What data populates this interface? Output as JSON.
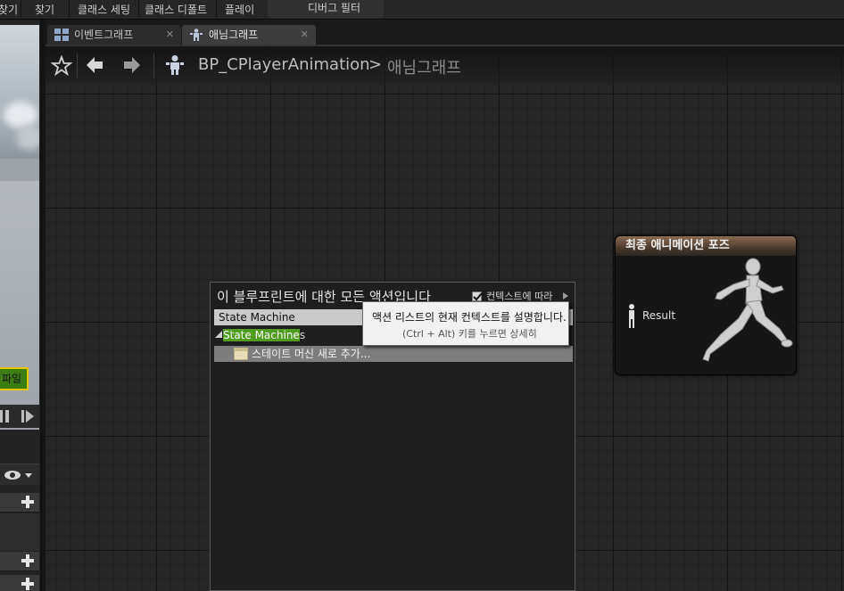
{
  "toolbar": {
    "items": [
      "찾기",
      "찾기",
      "클래스 세팅",
      "클래스 디폴트",
      "플레이"
    ],
    "debug_filter": "디버그 필터"
  },
  "left_panel": {
    "compile_label": "파일"
  },
  "tabs": [
    {
      "label": "이벤트그래프",
      "active": false
    },
    {
      "label": "애님그래프",
      "active": true
    }
  ],
  "breadcrumb": {
    "blueprint": "BP_CPlayerAnimation",
    "separator": ">",
    "graph": "애님그래프"
  },
  "result_node": {
    "title": "최종 애니메이션 포즈",
    "pin_label": "Result"
  },
  "action_menu": {
    "title": "이 블루프린트에 대한 모든 액션입니다",
    "context_label": "컨텍스트에 따라",
    "context_checked": true,
    "search_value": "State Machine",
    "category": {
      "highlight": "State Machine",
      "rest": "s"
    },
    "item_label": "스테이트 머신 새로 추가..."
  },
  "tooltip": {
    "main": "액션 리스트의 현재 컨텍스트를 설명합니다.",
    "sub": "(Ctrl + Alt) 키를 누르면 상세히"
  },
  "colors": {
    "highlight_green": "#4f9d1f",
    "compile_border": "#e8c800",
    "node_header": "#8a6b52"
  }
}
